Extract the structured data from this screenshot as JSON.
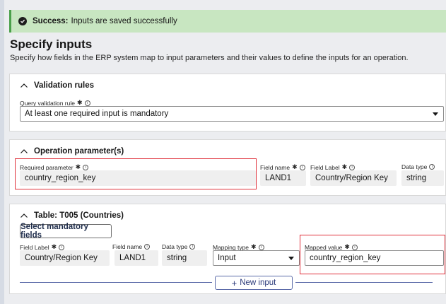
{
  "alert": {
    "title": "Success:",
    "message": "Inputs are saved successfully"
  },
  "page": {
    "title": "Specify inputs",
    "description": "Specify how fields in the ERP system map to input parameters and their values to define the inputs for an operation."
  },
  "validation": {
    "header": "Validation rules",
    "query_label": "Query validation rule",
    "query_value": "At least one required input is mandatory"
  },
  "operation": {
    "header": "Operation parameter(s)",
    "required_param_label": "Required parameter",
    "required_param_value": "country_region_key",
    "field_name_label": "Field name",
    "field_name_value": "LAND1",
    "field_label_label": "Field Label",
    "field_label_value": "Country/Region Key",
    "data_type_label": "Data type",
    "data_type_value": "string"
  },
  "table": {
    "header": "Table: T005 (Countries)",
    "select_button": "Select mandatory fields",
    "field_label_label": "Field Label",
    "field_label_value": "Country/Region Key",
    "field_name_label": "Field name",
    "field_name_value": "LAND1",
    "data_type_label": "Data type",
    "data_type_value": "string",
    "mapping_type_label": "Mapping type",
    "mapping_type_value": "Input",
    "mapped_value_label": "Mapped value",
    "mapped_value_value": "country_region_key",
    "new_input_button": "New input",
    "new_input_icon": "+"
  },
  "icons": {
    "success": "check-circle-icon",
    "collapse": "chevron-up-icon",
    "info": "info-icon",
    "dropdown": "caret-down-icon"
  },
  "colors": {
    "success_bg": "#c8e6c1",
    "highlight": "#e0313b",
    "accent": "#2b3a7a"
  }
}
